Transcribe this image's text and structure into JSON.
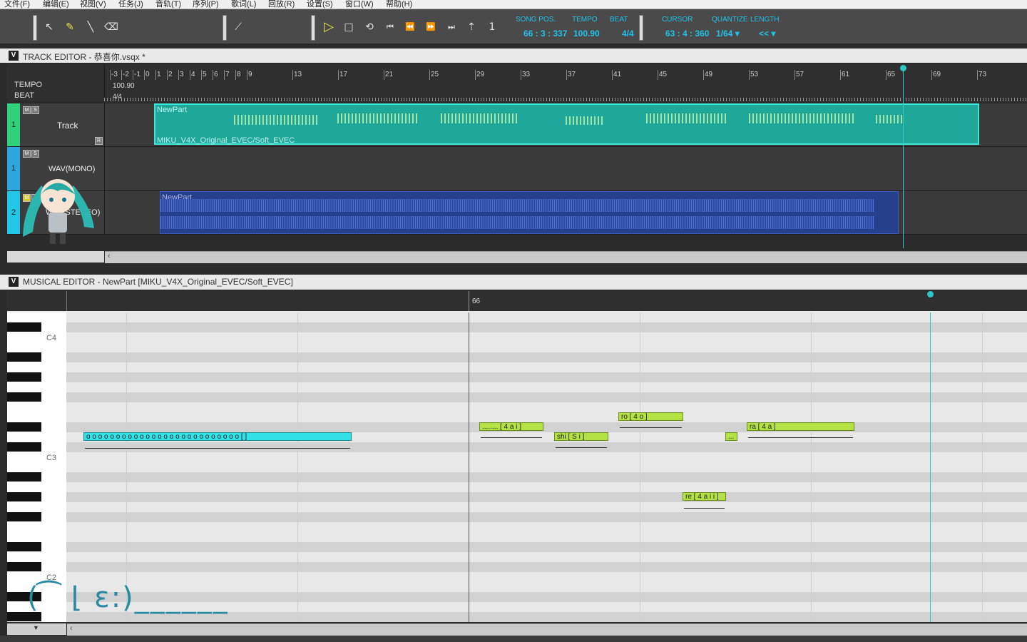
{
  "menu": [
    "文件(F)",
    "编辑(E)",
    "视图(V)",
    "任务(J)",
    "音轨(T)",
    "序列(P)",
    "歌词(L)",
    "回放(R)",
    "设置(S)",
    "窗口(W)",
    "帮助(H)"
  ],
  "toolbar": {
    "song_pos_label": "SONG POS.",
    "song_pos": "66 : 3 : 337",
    "tempo_label": "TEMPO",
    "tempo": "100.90",
    "beat_label": "BEAT",
    "beat": "4/4",
    "cursor_label": "CURSOR",
    "cursor": "63 : 4 : 360",
    "quantize_label": "QUANTIZE",
    "quantize": "1/64 ▾",
    "length_label": "LENGTH",
    "length": "<< ▾"
  },
  "track_editor": {
    "title": "TRACK EDITOR - 恭喜你.vsqx *",
    "tempo_label": "TEMPO",
    "beat_label": "BEAT",
    "tempo_value": "100.90",
    "beat_value": "4/4",
    "ruler": [
      "-3",
      "-2",
      "-1",
      "0",
      "1",
      "2",
      "3",
      "4",
      "5",
      "6",
      "7",
      "8",
      "9",
      "13",
      "17",
      "21",
      "25",
      "29",
      "33",
      "37",
      "41",
      "45",
      "49",
      "53",
      "57",
      "61",
      "65",
      "69",
      "73"
    ],
    "tracks": [
      {
        "num": "1",
        "name": "Track",
        "part_name": "NewPart",
        "singer": "MIKU_V4X_Original_EVEC/Soft_EVEC",
        "color": "#2fd17a"
      },
      {
        "num": "1",
        "name": "WAV(MONO)",
        "color": "#2da6e0"
      },
      {
        "num": "2",
        "name": "WAV(STEREO)",
        "part_name": "NewPart",
        "color": "#23c6e8"
      }
    ]
  },
  "musical_editor": {
    "title": "MUSICAL EDITOR - NewPart [MIKU_V4X_Original_EVEC/Soft_EVEC]",
    "measure_label": "66",
    "keys": [
      "C4",
      "C3",
      "C2"
    ],
    "notes": [
      {
        "lyric": "o o o o o o o o o o o o o o o o o o o o o o o o o o [ ]",
        "selected": true
      },
      {
        "lyric": "........ [ 4 a i ]"
      },
      {
        "lyric": "shi [ S i ]"
      },
      {
        "lyric": "ro [ 4 o ]"
      },
      {
        "lyric": "..."
      },
      {
        "lyric": "ra [ 4 a ]"
      },
      {
        "lyric": "re [ 4 a i i ]"
      }
    ]
  },
  "overlay_face": "(⁠ ͡ ⁠ ⌊ ε:)______"
}
